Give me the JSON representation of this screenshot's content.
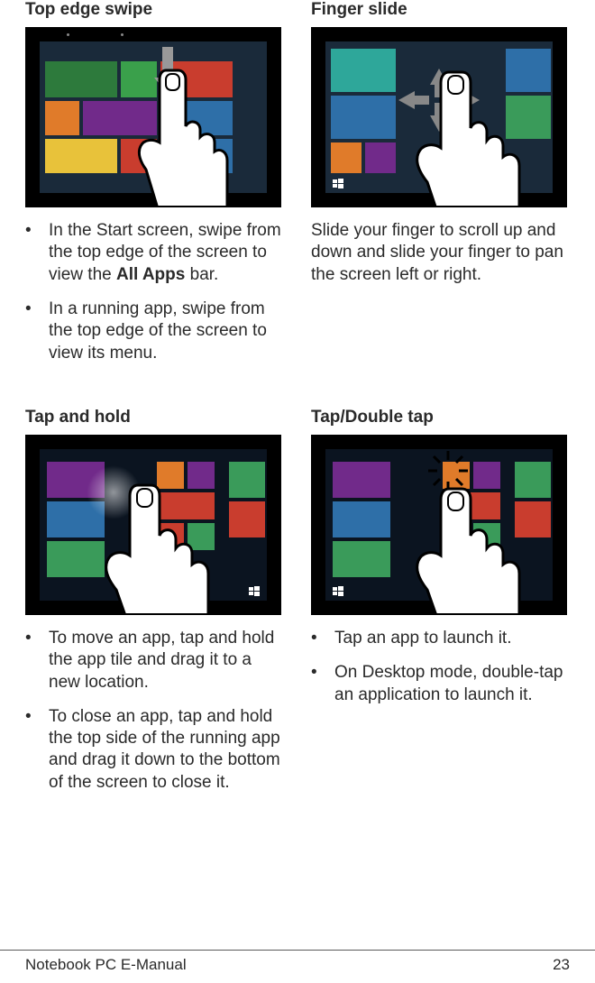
{
  "sections": {
    "top_edge_swipe": {
      "heading": "Top edge swipe",
      "bullets": [
        {
          "pre": "In the Start screen, swipe from the top edge of the screen to view the ",
          "bold": "All Apps",
          "post": " bar."
        },
        {
          "pre": "In a running app, swipe from the top edge of the screen to view its menu.",
          "bold": "",
          "post": ""
        }
      ]
    },
    "finger_slide": {
      "heading": "Finger slide",
      "text": "Slide your finger to scroll up and down and slide your finger to pan the screen left or right."
    },
    "tap_and_hold": {
      "heading": "Tap and hold",
      "bullets": [
        "To move an app, tap and hold the app tile and drag it to a new location.",
        "To close an app, tap and hold the top side of the running app and drag it down to the bottom of the screen to close it."
      ]
    },
    "tap_double_tap": {
      "heading": "Tap/Double tap",
      "bullets": [
        "Tap an app to launch it.",
        "On Desktop mode, double-tap an application to launch it."
      ]
    }
  },
  "footer": {
    "left": "Notebook PC E-Manual",
    "right": "23"
  }
}
